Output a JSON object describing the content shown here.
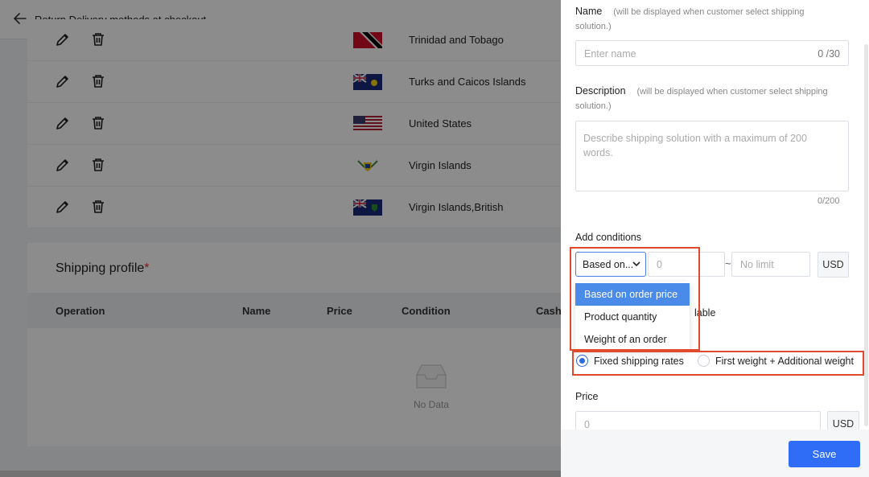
{
  "header": {
    "back_icon": "arrow-left-icon",
    "title": "Return Delivery methods at checkout"
  },
  "countries": [
    {
      "name": "Trinidad and Tobago"
    },
    {
      "name": "Turks and Caicos Islands"
    },
    {
      "name": "United States"
    },
    {
      "name": "Virgin Islands"
    },
    {
      "name": "Virgin Islands,British"
    }
  ],
  "shipping_profile": {
    "title": "Shipping profile",
    "required_mark": "*",
    "columns": [
      "Operation",
      "Name",
      "Price",
      "Condition",
      "Cash"
    ],
    "empty_text": "No Data"
  },
  "drawer": {
    "name_label": "Name",
    "name_hint": "(will be displayed when customer select shipping",
    "name_hint_2": "solution.)",
    "name_placeholder": "Enter name",
    "name_counter": "0 /30",
    "description_label": "Description",
    "description_hint": "(will be displayed when customer select shipping",
    "description_hint_2": "solution.)",
    "description_placeholder_1": "Describe shipping solution with a maximum of 200",
    "description_placeholder_2": "words.",
    "description_counter": "0/200",
    "conditions_label": "Add conditions",
    "condition_select_value": "Based on...",
    "condition_min_placeholder": "0",
    "range_separator": "~",
    "condition_max_placeholder": "No limit",
    "condition_unit": "USD",
    "dropdown_options": [
      "Based on order price",
      "Product quantity",
      "Weight of an order"
    ],
    "selected_option_index": 0,
    "hidden_partial_text": "lable",
    "rate_options": [
      "Fixed shipping rates",
      "First weight + Additional weight"
    ],
    "selected_rate_index": 0,
    "price_label": "Price",
    "price_placeholder": "0",
    "price_unit": "USD",
    "save_label": "Save"
  },
  "colors": {
    "primary": "#2f6df6",
    "highlight": "#e24a2d",
    "dropdown_active": "#4a8ae8"
  }
}
